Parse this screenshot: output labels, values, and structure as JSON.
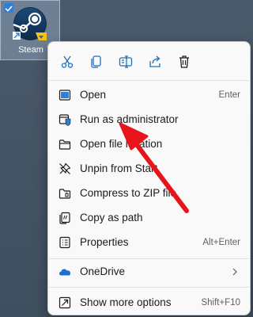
{
  "desktop": {
    "icon_label": "Steam",
    "icon_name": "steam-icon"
  },
  "context_menu": {
    "toolbar": [
      {
        "name": "cut-button",
        "icon": "scissors-icon"
      },
      {
        "name": "copy-button",
        "icon": "copy-icon"
      },
      {
        "name": "rename-button",
        "icon": "rename-icon"
      },
      {
        "name": "share-button",
        "icon": "share-icon"
      },
      {
        "name": "delete-button",
        "icon": "trash-icon"
      }
    ],
    "items": {
      "open": {
        "label": "Open",
        "shortcut": "Enter",
        "icon": "app-window-icon"
      },
      "run_as_admin": {
        "label": "Run as administrator",
        "icon": "shield-window-icon"
      },
      "open_file_location": {
        "label": "Open file location",
        "icon": "folder-icon"
      },
      "unpin_from_start": {
        "label": "Unpin from Start",
        "icon": "unpin-icon"
      },
      "compress_zip": {
        "label": "Compress to ZIP file",
        "icon": "zip-folder-icon"
      },
      "copy_as_path": {
        "label": "Copy as path",
        "icon": "copy-path-icon"
      },
      "properties": {
        "label": "Properties",
        "shortcut": "Alt+Enter",
        "icon": "properties-icon"
      },
      "onedrive": {
        "label": "OneDrive",
        "icon": "cloud-icon"
      },
      "show_more": {
        "label": "Show more options",
        "shortcut": "Shift+F10",
        "icon": "show-more-icon"
      }
    }
  },
  "annotation": {
    "arrow_color": "#e8141c",
    "points_to": "run_as_admin"
  },
  "colors": {
    "accent": "#2f7fd6",
    "menu_bg": "#f9f9f9",
    "arrow": "#e8141c"
  }
}
